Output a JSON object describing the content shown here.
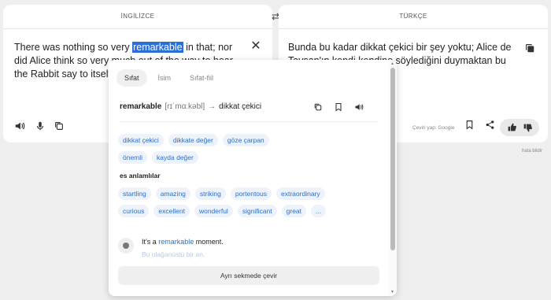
{
  "source": {
    "lang": "İNGİLİZCE",
    "text_before": "There was nothing so very ",
    "highlight": "remarkable",
    "text_after": " in that; nor did Alice think so very much out of the way to hear the Rabbit say to itself"
  },
  "target": {
    "lang": "TÜRKÇE",
    "text": "Bunda bu kadar dikkat çekici bir şey yoktu; Alice de Tavşan'ın kendi kendine söylediğini duymaktan bu"
  },
  "credit": "Çeviri yap: Google",
  "report": "hata bildir",
  "popup": {
    "tabs": [
      "Sıfat",
      "İsim",
      "Sıfat-fiil"
    ],
    "word": "remarkable",
    "phonetic": "[rɪˈmɑːkəbl]",
    "arrow": "→",
    "translation": "dikkat çekici",
    "tr_chips": [
      "dikkat çekici",
      "dikkate değer",
      "göze çarpan",
      "önemli",
      "kayda değer"
    ],
    "synonyms_label": "es anlamlılar",
    "syn_chips": [
      "startling",
      "amazing",
      "striking",
      "portentous",
      "extraordinary",
      "curious",
      "excellent",
      "wonderful",
      "significant",
      "great",
      "..."
    ],
    "example_before": "It's a ",
    "example_kw": "remarkable",
    "example_after": " moment.",
    "example_tr": "Bu olağanüstü bir an.",
    "open_tab_button": "Ayrı sekmede çevir"
  },
  "icons": {
    "swap": "swap-icon",
    "close": "close-icon",
    "speaker": "speaker-icon",
    "mic": "mic-icon",
    "copy": "copy-icon",
    "bookmark": "bookmark-icon",
    "share": "share-icon",
    "thumbs_up": "thumbs-up-icon",
    "thumbs_down": "thumbs-down-icon"
  }
}
